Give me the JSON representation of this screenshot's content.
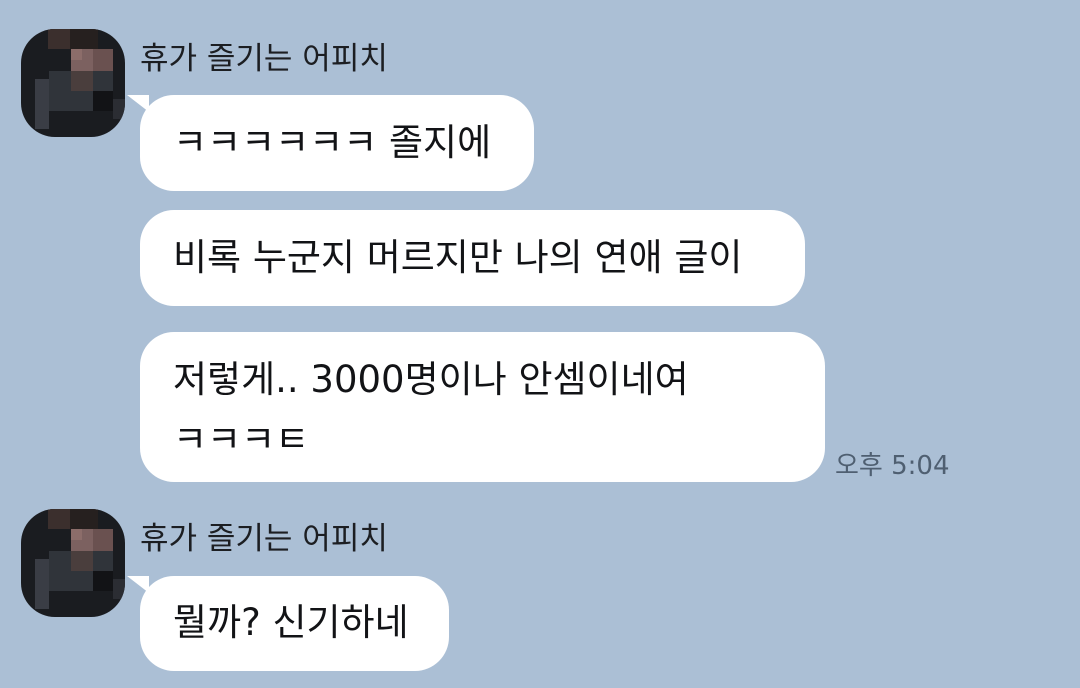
{
  "chat": {
    "groups": [
      {
        "sender": "휴가 즐기는 어피치",
        "messages": [
          "ㅋㅋㅋㅋㅋㅋ 졸지에",
          "비록 누군지 머르지만 나의 연애 글이",
          "저렇게.. 3000명이나 안셈이네여 ㅋㅋㅋㅌ"
        ],
        "time": "오후 5:04"
      },
      {
        "sender": "휴가 즐기는 어피치",
        "messages": [
          "뭘까? 신기하네"
        ]
      }
    ]
  },
  "colors": {
    "background": "#abbfd5",
    "bubble": "#ffffff",
    "text": "#121316",
    "timestamp": "#4f5f71"
  },
  "icons": {
    "avatar": "avatar-pixelated"
  }
}
